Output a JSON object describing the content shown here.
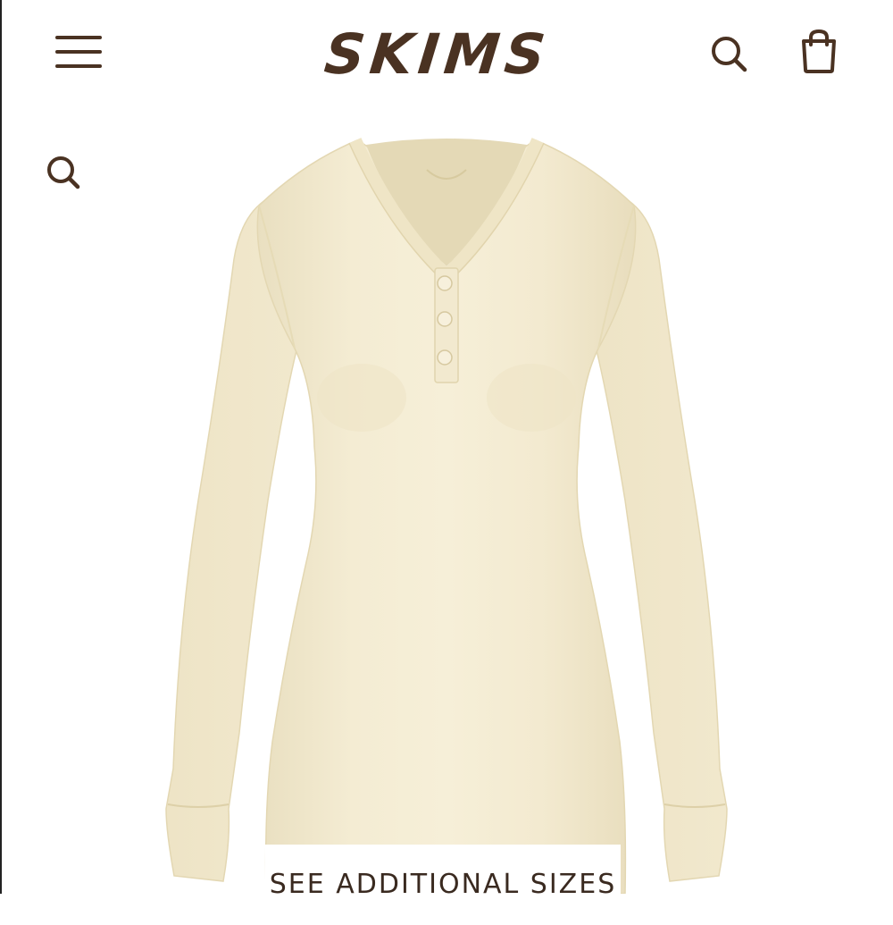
{
  "header": {
    "logo_text": "SKIMS",
    "menu_icon": "hamburger-menu-icon",
    "search_icon": "search-icon",
    "cart_icon": "shopping-bag-icon"
  },
  "page": {
    "search_icon": "search-icon"
  },
  "product": {
    "image_icon": "product-henley-shirt-image",
    "see_sizes_label": "SEE ADDITIONAL SIZES"
  },
  "colors": {
    "brand": "#4a3222",
    "garment": "#f1e8cc",
    "background": "#ffffff"
  }
}
